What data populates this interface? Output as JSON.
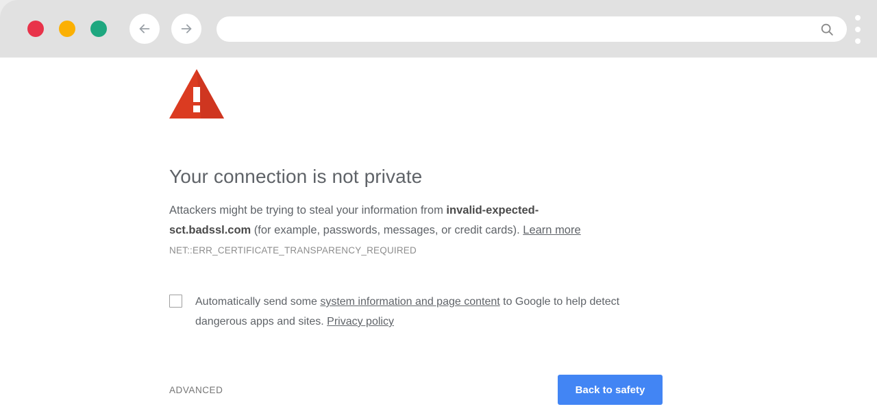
{
  "browser": {
    "window_controls": [
      {
        "name": "close",
        "color": "#e8334a"
      },
      {
        "name": "minimize",
        "color": "#fbb003"
      },
      {
        "name": "maximize",
        "color": "#1ea77f"
      }
    ],
    "back_label": "Back",
    "forward_label": "Forward",
    "omnibox": {
      "value": "",
      "placeholder": ""
    },
    "search_icon": "search-icon",
    "menu_label": "Customize and control"
  },
  "interstitial": {
    "icon": "warning-triangle-icon",
    "icon_color": "#db3b21",
    "heading": "Your connection is not private",
    "body": {
      "before_host": "Attackers might be trying to steal your information from ",
      "host": "invalid-expected-sct.badssl.com",
      "after_host": " (for example, passwords, messages, or credit cards). ",
      "learn_more": "Learn more"
    },
    "error_code": "NET::ERR_CERTIFICATE_TRANSPARENCY_REQUIRED",
    "optin": {
      "checked": false,
      "text_before_link": "Automatically send some ",
      "link1": "system information and page content",
      "text_middle": " to Google to help detect dangerous apps and sites. ",
      "link2": "Privacy policy"
    },
    "advanced_label": "ADVANCED",
    "safety_label": "Back to safety",
    "safety_color": "#4285f4"
  }
}
